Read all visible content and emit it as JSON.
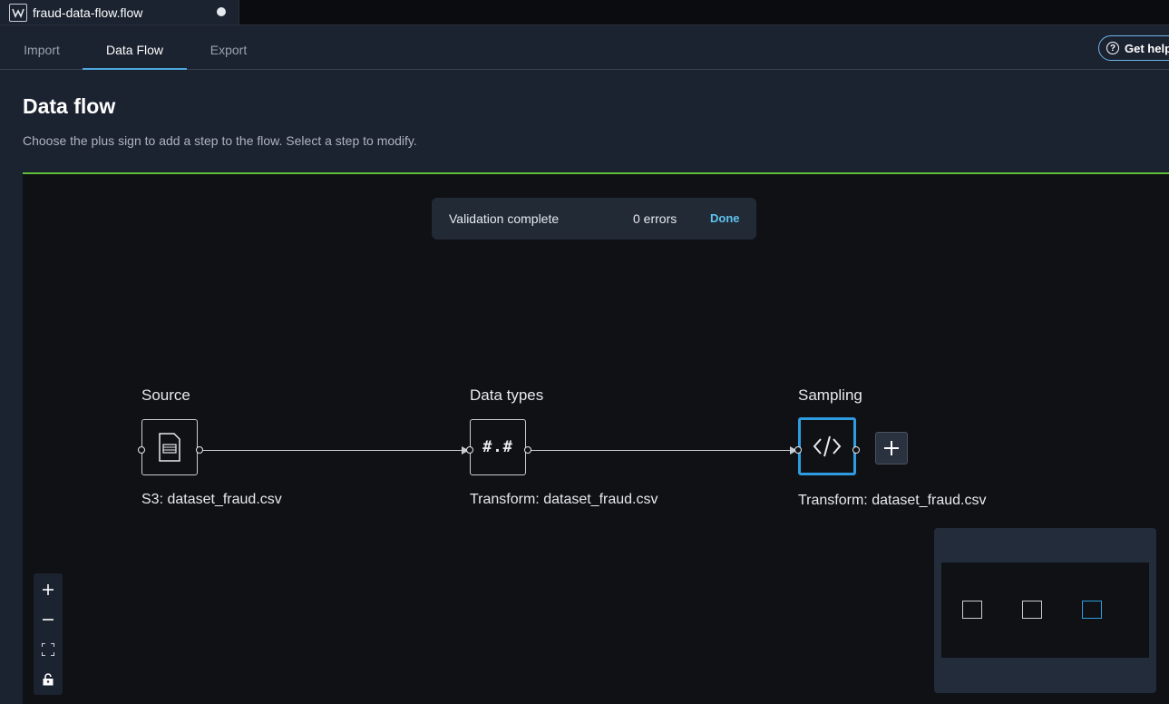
{
  "file_tab": {
    "name": "fraud-data-flow.flow",
    "logo_icon": "sagemaker-logo-icon",
    "unsaved_icon": "unsaved-dot-icon"
  },
  "nav": {
    "tabs": [
      {
        "label": "Import"
      },
      {
        "label": "Data Flow",
        "active": true
      },
      {
        "label": "Export"
      }
    ],
    "help_label": "Get help"
  },
  "header": {
    "title": "Data flow",
    "subtitle": "Choose the plus sign to add a step to the flow. Select a step to modify."
  },
  "toast": {
    "message": "Validation complete",
    "errors": "0 errors",
    "done_label": "Done"
  },
  "flow": {
    "nodes": [
      {
        "label": "Source",
        "caption": "S3: dataset_fraud.csv",
        "icon": "file-icon"
      },
      {
        "label": "Data types",
        "caption": "Transform: dataset_fraud.csv",
        "icon_text": "#.#"
      },
      {
        "label": "Sampling",
        "caption": "Transform: dataset_fraud.csv",
        "icon": "code-icon",
        "selected": true
      }
    ],
    "add_step_icon": "plus-icon"
  },
  "zoom_controls": [
    "zoom-in-icon",
    "zoom-out-icon",
    "fit-view-icon",
    "lock-icon"
  ],
  "colors": {
    "accent": "#2f9be0",
    "canvas_border": "#5fbf3a",
    "link": "#5ec3ee"
  }
}
